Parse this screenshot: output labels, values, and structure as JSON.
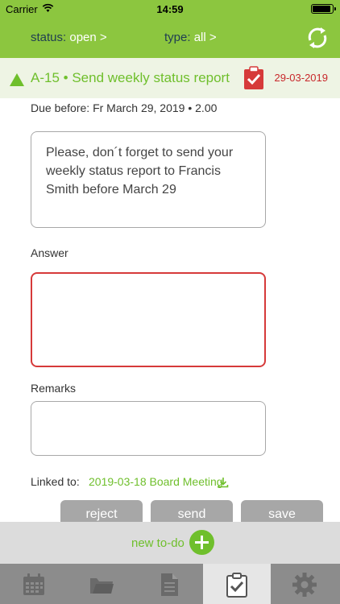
{
  "status_bar": {
    "carrier": "Carrier",
    "time": "14:59"
  },
  "filters": {
    "status_label": "status:",
    "status_value": "open >",
    "type_label": "type:",
    "type_value": "all >"
  },
  "task": {
    "id": "A-15",
    "separator": "•",
    "title": "Send weekly status report",
    "date": "29-03-2019"
  },
  "due": {
    "label": "Due before:",
    "value": "Fr March 29, 2019",
    "separator": "•",
    "extra": "2.00"
  },
  "description": "Please, don´t forget to send your weekly status report to Francis Smith before March 29",
  "answer": {
    "label": "Answer",
    "value": ""
  },
  "remarks": {
    "label": "Remarks",
    "value": ""
  },
  "linked": {
    "label": "Linked to:",
    "link": "2019-03-18 Board Meeting"
  },
  "actions": {
    "reject": "reject",
    "send": "send",
    "save": "save"
  },
  "new_todo": {
    "label": "new to-do"
  },
  "tabs": [
    {
      "icon": "calendar-icon",
      "active": false
    },
    {
      "icon": "folder-icon",
      "active": false
    },
    {
      "icon": "document-icon",
      "active": false
    },
    {
      "icon": "todo-clipboard-icon",
      "active": true
    },
    {
      "icon": "gear-icon",
      "active": false
    }
  ],
  "colors": {
    "accent": "#8cc63f",
    "link": "#6fbf2c",
    "alert": "#d63a3a",
    "tabbar": "#8c8c8c"
  }
}
